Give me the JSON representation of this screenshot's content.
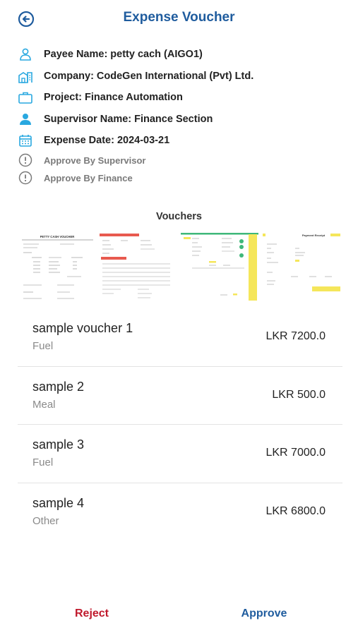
{
  "header": {
    "title": "Expense Voucher",
    "back_icon": "arrow-left-circle-icon"
  },
  "details": {
    "payee": "Payee Name: petty cach (AIGO1)",
    "company": "Company: CodeGen International (Pvt) Ltd.",
    "project": "Project: Finance Automation",
    "supervisor": "Supervisor Name: Finance Section",
    "expense_date": "Expense Date: 2024-03-21",
    "approve_supervisor": "Approve By Supervisor",
    "approve_finance": "Approve By Finance"
  },
  "vouchers": {
    "heading": "Vouchers",
    "thumbnail_titles": [
      "PETTY CASH VOUCHER",
      "Payment Receipt"
    ],
    "items": [
      {
        "name": "sample voucher 1",
        "category": "Fuel",
        "amount": "LKR 7200.0"
      },
      {
        "name": "sample 2",
        "category": "Meal",
        "amount": "LKR 500.0"
      },
      {
        "name": "sample 3",
        "category": "Fuel",
        "amount": "LKR 7000.0"
      },
      {
        "name": "sample 4",
        "category": "Other",
        "amount": "LKR 6800.0"
      }
    ]
  },
  "footer": {
    "reject_label": "Reject",
    "approve_label": "Approve"
  },
  "colors": {
    "accent": "#1f5c9e",
    "icon": "#29a8e0",
    "reject": "#c0192c",
    "muted": "#7a7a7a",
    "highlight": "#f5e65a"
  }
}
